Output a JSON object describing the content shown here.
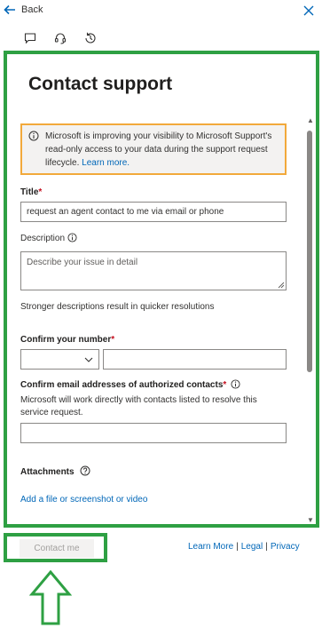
{
  "header": {
    "back_label": "Back",
    "icons": [
      "chat-icon",
      "headset-icon",
      "history-icon",
      "close-icon"
    ]
  },
  "panel": {
    "title": "Contact support",
    "notice": {
      "text": "Microsoft is improving your visibility to Microsoft Support's read-only access to your data during the support request lifecycle.",
      "link": "Learn more."
    },
    "title_field": {
      "label": "Title",
      "required_mark": "*",
      "value": "request an agent contact to me via email or phone"
    },
    "description_field": {
      "label": "Description",
      "placeholder": "Describe your issue in detail",
      "hint": "Stronger descriptions result in quicker resolutions"
    },
    "phone_field": {
      "label": "Confirm your number",
      "required_mark": "*"
    },
    "email_field": {
      "label": "Confirm email addresses of authorized contacts",
      "required_mark": "*",
      "help": "Microsoft will work directly with contacts listed to resolve this service request."
    },
    "attachments": {
      "label": "Attachments",
      "link": "Add a file or screenshot or video"
    }
  },
  "footer": {
    "contact_button": "Contact me",
    "links": [
      "Learn More",
      "Legal",
      "Privacy"
    ],
    "separator": "|"
  },
  "colors": {
    "highlight": "#2ea043",
    "notice_border": "#f2a93b",
    "link": "#0067b8",
    "required": "#c50f1f"
  }
}
